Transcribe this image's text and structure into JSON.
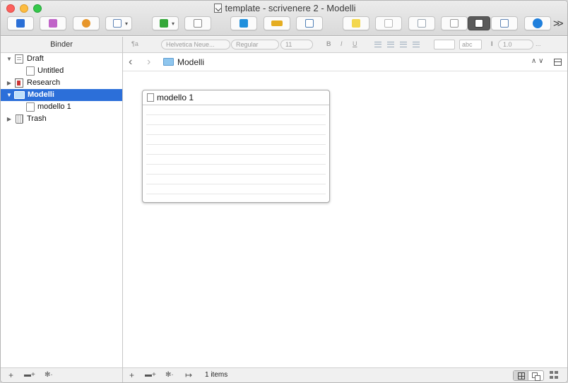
{
  "window": {
    "title": "template - scrivenere 2 - Modelli"
  },
  "toolbar": {
    "buttons": [
      {
        "name": "binder-toggle-icon",
        "color": "#2a6fd6"
      },
      {
        "name": "collections-icon",
        "color": "#c063c8"
      },
      {
        "name": "sync-icon",
        "color": "#e7962a"
      },
      {
        "name": "layout-icon",
        "color": "#5f84b5"
      },
      {
        "name": "add-icon",
        "color": "#35a83a"
      },
      {
        "name": "trash-icon",
        "color": "#8a8a8a"
      },
      {
        "name": "quick-reference-icon",
        "color": "#1f8fdc"
      },
      {
        "name": "keywords-icon",
        "color": "#e5ad21"
      },
      {
        "name": "edit-icon",
        "color": "#4f7fb5"
      },
      {
        "name": "comment-icon",
        "color": "#f3d74d"
      },
      {
        "name": "snapshot-icon",
        "color": "#b8b8b8"
      },
      {
        "name": "composition-icon",
        "color": "#9aa6b2"
      },
      {
        "name": "scrivenings-icon",
        "color": "#9a9a9a"
      },
      {
        "name": "corkboard-icon",
        "color": "#3f3f3f"
      },
      {
        "name": "outliner-icon",
        "color": "#5f84b5"
      },
      {
        "name": "inspector-icon",
        "color": "#1f7fdc"
      }
    ],
    "overflow_label": ">>"
  },
  "format_bar": {
    "paragraph_style": "¶a",
    "font": "Helvetica Neue...",
    "style": "Regular",
    "size": "11",
    "bold": "B",
    "italic": "I",
    "underline": "U",
    "highlight": "abc",
    "line_spacing": "1.0",
    "more": "..."
  },
  "binder": {
    "header": "Binder",
    "items": [
      {
        "label": "Draft",
        "icon": "draft-folder-icon",
        "triangle": "▼",
        "indent": 0
      },
      {
        "label": "Untitled",
        "icon": "document-icon",
        "triangle": "",
        "indent": 1
      },
      {
        "label": "Research",
        "icon": "research-folder-icon",
        "triangle": "▶",
        "indent": 0
      },
      {
        "label": "Modelli",
        "icon": "folder-icon",
        "triangle": "▼",
        "indent": 0,
        "selected": true
      },
      {
        "label": "modello 1",
        "icon": "document-icon",
        "triangle": "",
        "indent": 1
      },
      {
        "label": "Trash",
        "icon": "trash-icon",
        "triangle": "▶",
        "indent": 0
      }
    ],
    "footer": {
      "add": "+",
      "add_folder": "▬+",
      "settings": "✻·"
    }
  },
  "main": {
    "nav": {
      "back": "‹",
      "forward": "›",
      "title": "Modelli",
      "updown": "∧ ∨"
    },
    "cards": [
      {
        "title": "modello 1"
      }
    ],
    "footer": {
      "add": "+",
      "add_folder": "▬+",
      "settings": "✻·",
      "move": "↦",
      "count": "1 items"
    }
  }
}
